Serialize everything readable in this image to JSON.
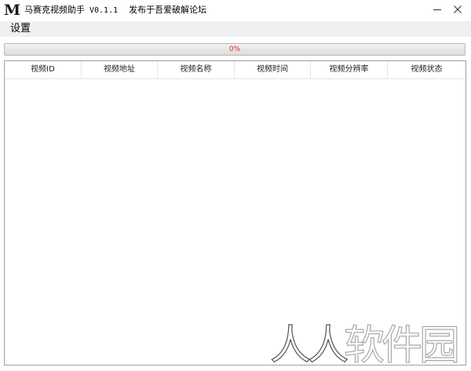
{
  "window": {
    "logo": "M",
    "app_name": "马赛克视频助手",
    "version": "V0.1.1",
    "subtitle": "发布于吾爱破解论坛"
  },
  "menu": {
    "items": [
      {
        "label": "设置"
      }
    ]
  },
  "progress": {
    "value": 0,
    "label": "0%",
    "label_color": "#e52222"
  },
  "table": {
    "columns": [
      "视频ID",
      "视频地址",
      "视频名称",
      "视频时间",
      "视频分辨率",
      "视频状态"
    ],
    "rows": []
  },
  "watermark": {
    "text": "人人软件园"
  },
  "icons": {
    "minimize": "minimize-icon",
    "close": "close-icon"
  }
}
